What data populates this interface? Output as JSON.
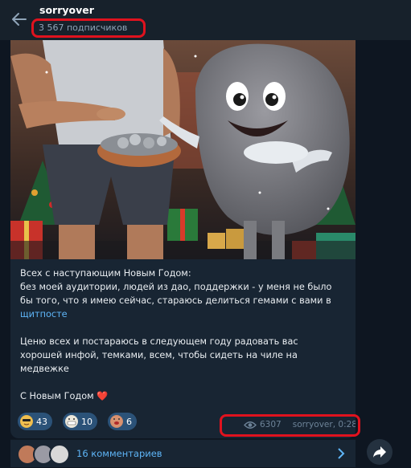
{
  "header": {
    "channel_name": "sorryover",
    "subscribers": "3 567 подписчиков"
  },
  "post": {
    "image_alt": "Muscular man giving coins to a smiling stone character",
    "text_lines": [
      "Всех с наступающим Новым Годом:",
      "без моей аудитории, людей из дао, поддержки - у меня не было",
      "бы того, что я имею сейчас, стараюсь делиться гемами с вами в"
    ],
    "link_text": "щитпосте",
    "text_lines_2": [
      "Ценю всех и постараюсь в следующем году радовать вас",
      "хорошей инфой, темками, всем, чтобы сидеть на чиле на",
      "медвежке"
    ],
    "closing": "С Новым Годом ❤️",
    "reactions": [
      {
        "icon": "cool-emoji-icon",
        "count": "43"
      },
      {
        "icon": "grin-emoji-icon",
        "count": "10"
      },
      {
        "icon": "kiss-emoji-icon",
        "count": "6"
      }
    ],
    "views": "6307",
    "author_time": "sorryover, 0:28"
  },
  "comments": {
    "label": "16 комментариев"
  },
  "colors": {
    "background": "#0e1621",
    "header": "#17212b",
    "bubble": "#182533",
    "link": "#5eb5f7",
    "highlight": "#e0121e"
  }
}
